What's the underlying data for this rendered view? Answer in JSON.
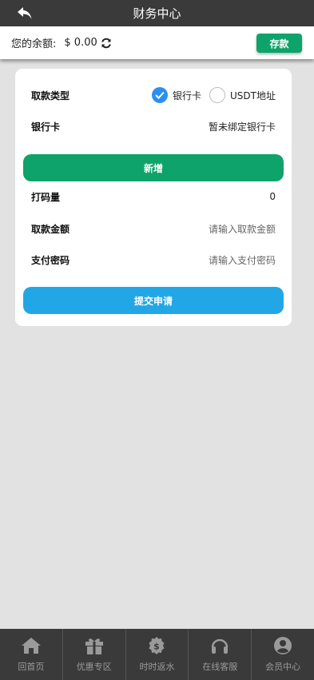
{
  "header": {
    "title": "财务中心"
  },
  "balance": {
    "label": "您的余额:",
    "amount": "$ 0.00",
    "deposit_label": "存款"
  },
  "form": {
    "type_label": "取款类型",
    "options": [
      {
        "label": "银行卡",
        "selected": true
      },
      {
        "label": "USDT地址",
        "selected": false
      }
    ],
    "bank_label": "银行卡",
    "bank_value": "暂未绑定银行卡",
    "add_label": "新增",
    "bet_label": "打码量",
    "bet_value": "0",
    "amount_label": "取款金额",
    "amount_placeholder": "请输入取款金额",
    "password_label": "支付密码",
    "password_placeholder": "请输入支付密码",
    "submit_label": "提交申请"
  },
  "tabs": [
    {
      "label": "回首页",
      "icon": "home-icon"
    },
    {
      "label": "优惠专区",
      "icon": "gift-icon"
    },
    {
      "label": "时时返水",
      "icon": "money-bag-icon"
    },
    {
      "label": "在线客服",
      "icon": "headset-icon"
    },
    {
      "label": "会员中心",
      "icon": "user-icon"
    }
  ],
  "colors": {
    "green": "#0ea36a",
    "blue": "#22a7e6",
    "radio_blue": "#2a8ff0",
    "bar": "#3a3a3a"
  }
}
